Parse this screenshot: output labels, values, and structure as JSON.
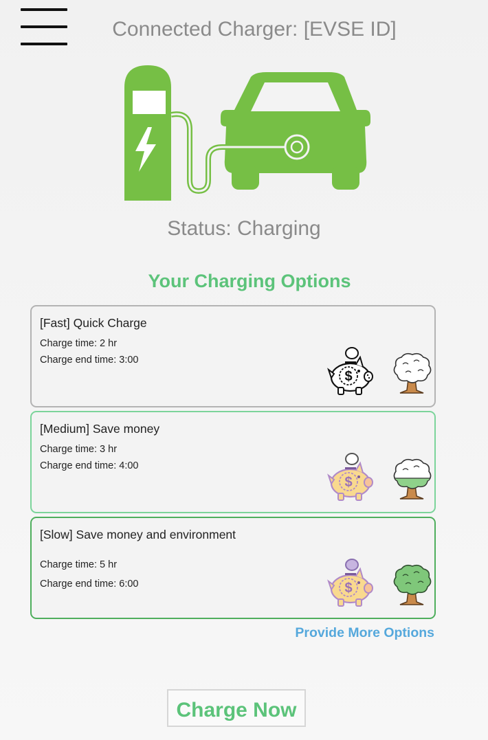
{
  "header": {
    "title": "Connected Charger: [EVSE ID]",
    "menu_icon": "hamburger-menu-icon"
  },
  "hero": {
    "icon": "ev-charger-car-icon",
    "accent_color": "#76bf45"
  },
  "status": {
    "text": "Status: Charging"
  },
  "options": {
    "title": "Your Charging Options",
    "items": [
      {
        "title": "[Fast] Quick Charge",
        "charge_time": "Charge time: 2 hr",
        "end_time": "Charge end time: 3:00",
        "border_color": "#b3b3b3",
        "savings_icon": "piggy-bank-outline-icon",
        "eco_icon": "tree-empty-icon",
        "eco_level": 0
      },
      {
        "title": "[Medium] Save money",
        "charge_time": "Charge time: 3 hr",
        "end_time": "Charge end time: 4:00",
        "border_color": "#7bd49a",
        "savings_icon": "piggy-bank-filled-icon",
        "eco_icon": "tree-partial-icon",
        "eco_level": 0.2
      },
      {
        "title": "[Slow] Save money and environment",
        "charge_time": "Charge time: 5 hr",
        "end_time": "Charge end time: 6:00",
        "border_color": "#4eae5c",
        "savings_icon": "piggy-bank-filled-icon",
        "eco_icon": "tree-full-icon",
        "eco_level": 1
      }
    ]
  },
  "more_options_label": "Provide More Options",
  "charge_button_label": "Charge Now",
  "colors": {
    "green_text": "#5cc37a",
    "link_blue": "#55a8dc",
    "gray_text": "#8a8a8a"
  }
}
